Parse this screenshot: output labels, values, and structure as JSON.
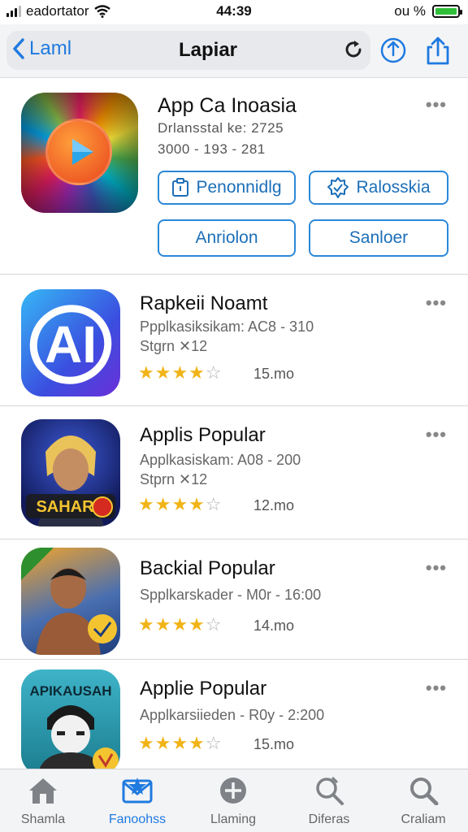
{
  "status_bar": {
    "carrier": "eadortator",
    "time": "44:39",
    "right_text": "ou %"
  },
  "nav": {
    "back_label": "Laml",
    "title": "Lapiar"
  },
  "featured": {
    "title": "App Ca Inoasia",
    "line1": "Drlansstal ke: 2725",
    "line2": "3000 - 193 - 281",
    "buttons": [
      {
        "label": "Penonnidlg",
        "icon": "clipboard-icon"
      },
      {
        "label": "Ralosskia",
        "icon": "gear-badge-icon"
      },
      {
        "label": "Anriolon"
      },
      {
        "label": "Sanloer"
      }
    ],
    "more": "•••"
  },
  "apps": [
    {
      "title": "Rapkeii Noamt",
      "meta1": "Ppplkasiksikam: AC8 - 310",
      "meta2": "Stgrn ✕12",
      "rating": 4,
      "size": "15.mo",
      "icon": "ai-logo-icon"
    },
    {
      "title": "Applis Popular",
      "meta1": "Applkasiskam: A08 - 200",
      "meta2": "Stprn ✕12",
      "rating": 4,
      "size": "12.mo",
      "icon": "hero-game-icon",
      "icon_text": "SAHAR"
    },
    {
      "title": "Backial Popular",
      "meta1": "Spplkarskader - M0r - 16:00",
      "meta2": "",
      "rating": 4,
      "size": "14.mo",
      "icon": "warrior-game-icon"
    },
    {
      "title": "Applie Popular",
      "meta1": "Applkarsiieden - R0y - 2:200",
      "meta2": "",
      "rating": 4,
      "size": "15.mo",
      "icon": "ninja-game-icon",
      "icon_text": "APIKAUSAH"
    }
  ],
  "tabs": [
    {
      "label": "Shamla",
      "icon": "home-icon",
      "active": false
    },
    {
      "label": "Fanoohss",
      "icon": "star-envelope-icon",
      "active": true
    },
    {
      "label": "Llaming",
      "icon": "plus-circle-icon",
      "active": false
    },
    {
      "label": "Diferas",
      "icon": "search-tag-icon",
      "active": false
    },
    {
      "label": "Craliam",
      "icon": "search-icon",
      "active": false
    }
  ],
  "colors": {
    "accent": "#1f7ae0",
    "star": "#f1b418",
    "battery": "#2fbf3a"
  }
}
